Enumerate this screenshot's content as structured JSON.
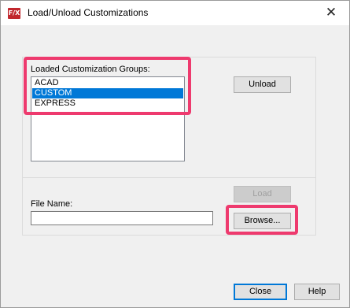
{
  "window": {
    "title": "Load/Unload Customizations",
    "app_icon_text": "F/X",
    "close_glyph": "✕"
  },
  "loaded_groups": {
    "label": "Loaded Customization Groups:",
    "items": [
      {
        "label": "ACAD",
        "selected": false
      },
      {
        "label": "CUSTOM",
        "selected": true
      },
      {
        "label": "EXPRESS",
        "selected": false
      }
    ]
  },
  "buttons": {
    "unload": "Unload",
    "load": "Load",
    "browse": "Browse...",
    "close": "Close",
    "help": "Help"
  },
  "file_name": {
    "label": "File Name:",
    "value": ""
  },
  "colors": {
    "highlight": "#ee3a6e",
    "selection": "#0078d7"
  }
}
